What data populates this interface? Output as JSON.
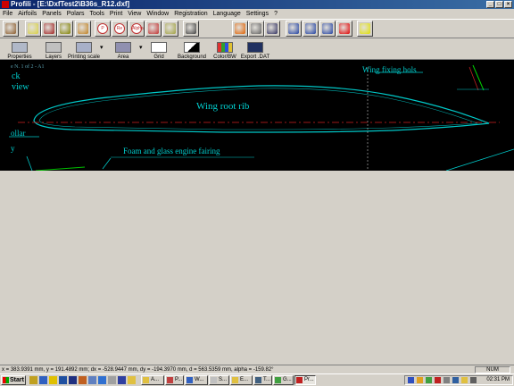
{
  "window": {
    "title": "Profili - [E:\\DxfTest2\\B36s_R12.dxf]"
  },
  "window_buttons": [
    "_",
    "□",
    "×"
  ],
  "menu": [
    "File",
    "Airfoils",
    "Panels",
    "Polars",
    "Tools",
    "Print",
    "View",
    "Window",
    "Registration",
    "Language",
    "Settings",
    "?"
  ],
  "toolbar1": [
    {
      "icon": "exit-door-icon",
      "color": "#8a5a2a"
    },
    {
      "icon": "wing-airfoil-icon",
      "color": "#d8d040"
    },
    {
      "icon": "book-icon",
      "color": "#a02020"
    },
    {
      "icon": "database-icon",
      "color": "#808000"
    },
    {
      "icon": "panel-stack-icon",
      "color": "#c08020"
    },
    {
      "icon": "cp-polar-icon",
      "color": "#c03030",
      "text": "P"
    },
    {
      "icon": "re-polar-icon",
      "color": "#c03030",
      "text": "Re"
    },
    {
      "icon": "alpha-polar-icon",
      "color": "#c03030",
      "text": "Alpha"
    },
    {
      "icon": "curve-polar-icon",
      "color": "#c03030"
    },
    {
      "icon": "airfoil-edit-icon",
      "color": "#a0a040"
    },
    {
      "icon": "grid-table-icon",
      "color": "#404040"
    },
    {
      "icon": "colored-chart-icon",
      "color": "#e06000"
    },
    {
      "icon": "printer-icon",
      "color": "#606060"
    },
    {
      "icon": "save-disk-icon",
      "color": "#303060"
    },
    {
      "icon": "zoom-in-icon",
      "color": "#2040a0"
    },
    {
      "icon": "zoom-out-icon",
      "color": "#2040a0"
    },
    {
      "icon": "window-tile-icon",
      "color": "#2040a0"
    },
    {
      "icon": "close-x-icon",
      "color": "#e00000"
    },
    {
      "icon": "help-bulb-icon",
      "color": "#e0e000"
    }
  ],
  "toolbar2": [
    {
      "label": "Properties",
      "icon": "properties-icon"
    },
    {
      "label": "Layers",
      "icon": "layers-icon"
    },
    {
      "label": "Printing scale",
      "icon": "printing-scale-icon",
      "dropdown": true
    },
    {
      "label": "Area",
      "icon": "area-icon",
      "dropdown": true
    },
    {
      "label": "Grid",
      "icon": "grid-icon"
    },
    {
      "label": "Background",
      "icon": "background-icon"
    },
    {
      "label": "Color/BW",
      "icon": "color-bw-icon"
    },
    {
      "label": "Export .DAT",
      "icon": "export-dat-icon"
    }
  ],
  "drawing": {
    "sheet_label": "e N. 1 of 2 - A1",
    "label_ck": "ck",
    "label_view": "view",
    "rib_label": "Wing root rib",
    "holes_label": "Wing fixing hols",
    "collar_label": "ollar",
    "y_label": "y",
    "fairing_label": "Foam and glass engine fairing",
    "colors": {
      "outline": "#00c8c8",
      "chord": "#d02020",
      "background": "#000000",
      "accent": "#00ff00"
    }
  },
  "status": {
    "coords": "x = 383.9391 mm, y = 191.4892 mm; dx = -528.9447 mm, dy = -194.3970 mm, d = 563.5359 mm, alpha = -159.82°",
    "num": "NUM"
  },
  "taskbar": {
    "start": "Start",
    "tasks": [
      "A...",
      "P...",
      "W...",
      "S...",
      "E...",
      "T...",
      "G...",
      "Pr..."
    ],
    "clock": "02:31 PM"
  }
}
